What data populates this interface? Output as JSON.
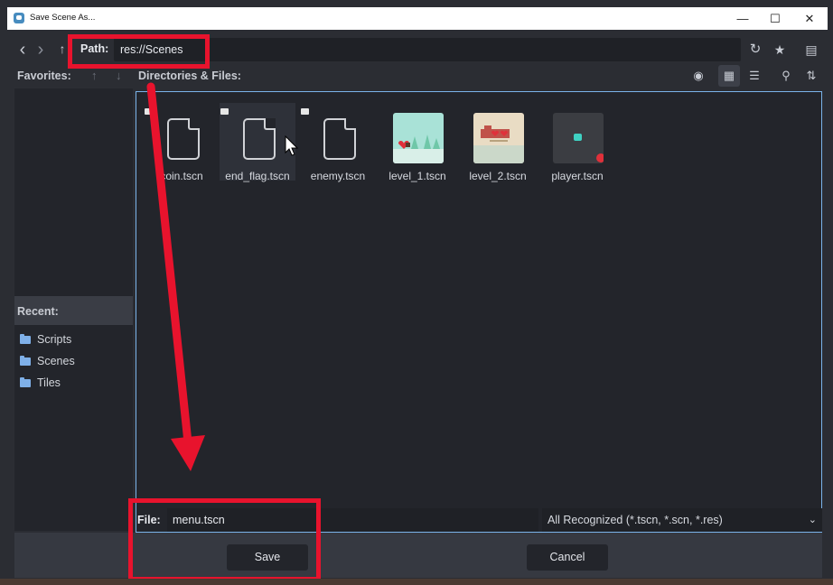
{
  "window": {
    "title": "Save Scene As...",
    "minimize": "—",
    "maximize": "☐",
    "close": "✕"
  },
  "toolbar": {
    "back_icon": "‹",
    "forward_icon": "›",
    "up_icon": "↑",
    "path_label": "Path:",
    "path_value": "res://Scenes",
    "refresh_icon": "↻",
    "favorite_icon": "★",
    "new_folder_icon": "▤"
  },
  "sections": {
    "favorites": "Favorites:",
    "directories": "Directories & Files:",
    "recent": "Recent:"
  },
  "view": {
    "toggle_hidden_icon": "◉",
    "grid_icon": "▦",
    "list_icon": "☰",
    "filter_icon": "⚲",
    "sort_icon": "⇅"
  },
  "recent": [
    {
      "label": "Scripts",
      "icon": "folder-icon"
    },
    {
      "label": "Scenes",
      "icon": "folder-icon"
    },
    {
      "label": "Tiles",
      "icon": "folder-icon"
    }
  ],
  "files": [
    {
      "name": "coin.tscn",
      "thumb": "scene-file-icon"
    },
    {
      "name": "end_flag.tscn",
      "thumb": "scene-file-icon"
    },
    {
      "name": "enemy.tscn",
      "thumb": "scene-file-icon"
    },
    {
      "name": "level_1.tscn",
      "thumb": "level-preview"
    },
    {
      "name": "level_2.tscn",
      "thumb": "level-preview"
    },
    {
      "name": "player.tscn",
      "thumb": "player-preview"
    }
  ],
  "file_field": {
    "label": "File:",
    "value": "menu.tscn"
  },
  "filter": {
    "value": "All Recognized (*.tscn, *.scn, *.res)",
    "chevron": "⌄"
  },
  "buttons": {
    "save": "Save",
    "cancel": "Cancel"
  },
  "annotation_color": "#e8132d",
  "accent_color": "#7bb4ea"
}
